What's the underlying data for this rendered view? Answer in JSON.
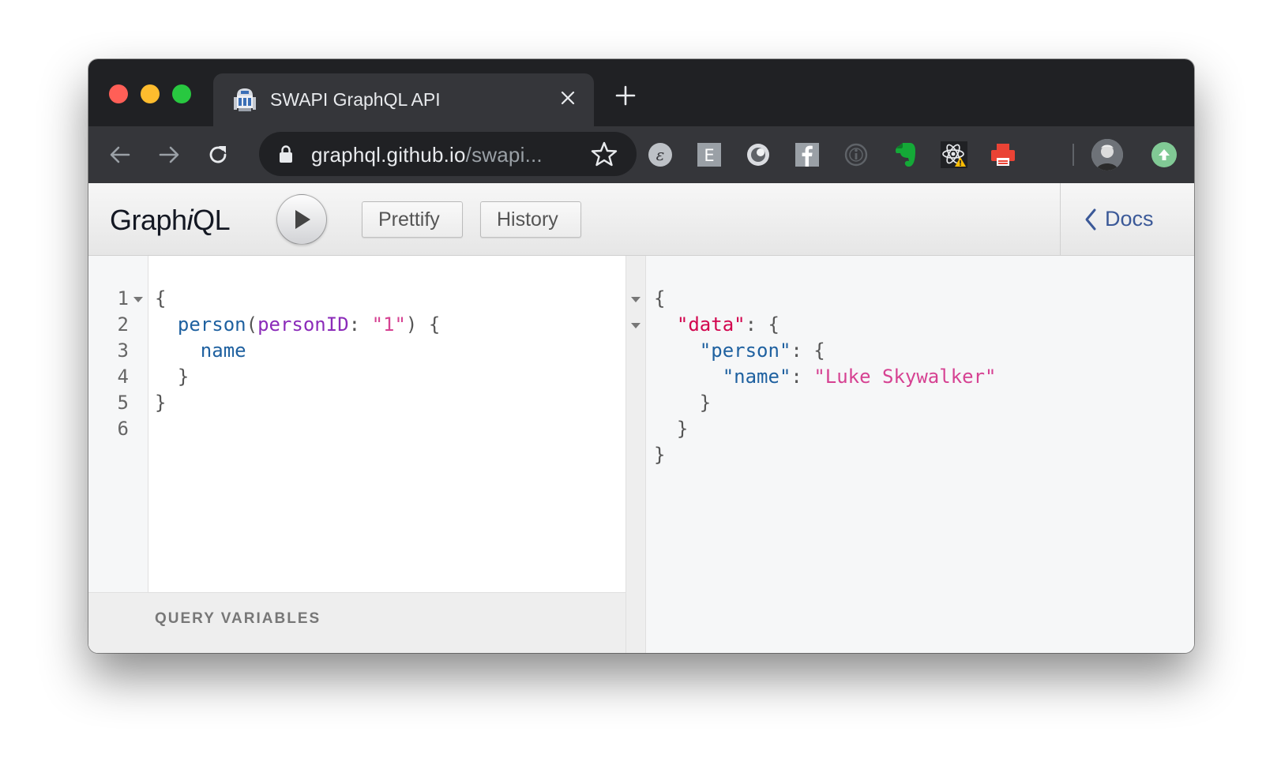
{
  "browser": {
    "tab_title": "SWAPI GraphQL API",
    "url_host": "graphql.github.io",
    "url_path": "/swapi...",
    "extensions": [
      "ember-icon",
      "e-extension-icon",
      "record-icon",
      "facebook-icon",
      "info-icon",
      "evernote-icon",
      "react-devtools-icon",
      "print-icon"
    ]
  },
  "graphiql": {
    "logo_prefix": "Graph",
    "logo_italic": "i",
    "logo_suffix": "QL",
    "prettify_label": "Prettify",
    "history_label": "History",
    "docs_label": "Docs",
    "query_variables_label": "QUERY VARIABLES"
  },
  "query_editor": {
    "line_numbers": [
      "1",
      "2",
      "3",
      "4",
      "5",
      "6"
    ],
    "open_brace": "{",
    "field": "person",
    "paren_open": "(",
    "arg": "personID",
    "colon": ": ",
    "arg_value": "\"1\"",
    "paren_close_brace": ") {",
    "subfield": "name",
    "inner_close": "}",
    "outer_close": "}"
  },
  "result_viewer": {
    "open_brace": "{",
    "data_key": "\"data\"",
    "person_key": "\"person\"",
    "name_key": "\"name\"",
    "name_value": "\"Luke Skywalker\"",
    "colon_brace": ": {",
    "colon": ": ",
    "close_brace": "}"
  },
  "colors": {
    "field": "#1f61a0",
    "argument": "#8b2bb9",
    "string": "#d64292",
    "result_key": "#d2054e",
    "docs_link": "#3b5998"
  }
}
